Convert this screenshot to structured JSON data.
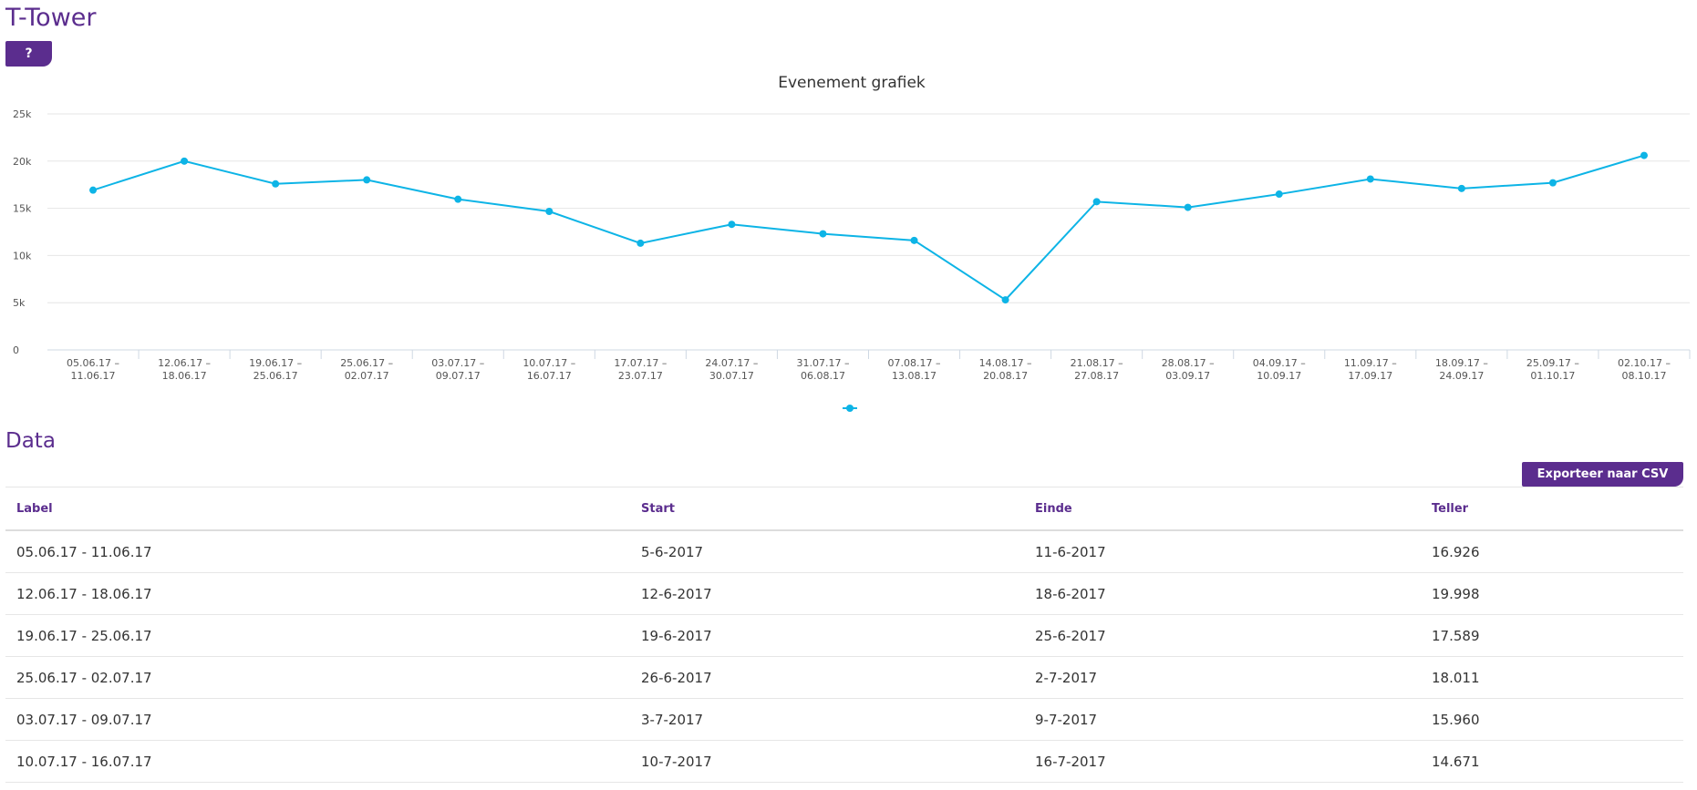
{
  "app": {
    "title": "T-Tower",
    "help_label": "?"
  },
  "data_section": {
    "title": "Data",
    "export_label": "Exporteer naar CSV"
  },
  "table": {
    "headers": {
      "label": "Label",
      "start": "Start",
      "end": "Einde",
      "count": "Teller"
    },
    "rows": [
      {
        "label": "05.06.17 - 11.06.17",
        "start": "5-6-2017",
        "end": "11-6-2017",
        "count": "16.926"
      },
      {
        "label": "12.06.17 - 18.06.17",
        "start": "12-6-2017",
        "end": "18-6-2017",
        "count": "19.998"
      },
      {
        "label": "19.06.17 - 25.06.17",
        "start": "19-6-2017",
        "end": "25-6-2017",
        "count": "17.589"
      },
      {
        "label": "25.06.17 - 02.07.17",
        "start": "26-6-2017",
        "end": "2-7-2017",
        "count": "18.011"
      },
      {
        "label": "03.07.17 - 09.07.17",
        "start": "3-7-2017",
        "end": "9-7-2017",
        "count": "15.960"
      },
      {
        "label": "10.07.17 - 16.07.17",
        "start": "10-7-2017",
        "end": "16-7-2017",
        "count": "14.671"
      }
    ]
  },
  "chart_data": {
    "type": "line",
    "title": "Evenement grafiek",
    "xlabel": "",
    "ylabel": "",
    "ylim": [
      0,
      25000
    ],
    "y_ticks": [
      {
        "value": 0,
        "label": "0"
      },
      {
        "value": 5000,
        "label": "5k"
      },
      {
        "value": 10000,
        "label": "10k"
      },
      {
        "value": 15000,
        "label": "15k"
      },
      {
        "value": 20000,
        "label": "20k"
      },
      {
        "value": 25000,
        "label": "25k"
      }
    ],
    "grid": true,
    "legend_position": "bottom",
    "categories": [
      [
        "05.06.17 –",
        "11.06.17"
      ],
      [
        "12.06.17 –",
        "18.06.17"
      ],
      [
        "19.06.17 –",
        "25.06.17"
      ],
      [
        "25.06.17 –",
        "02.07.17"
      ],
      [
        "03.07.17 –",
        "09.07.17"
      ],
      [
        "10.07.17 –",
        "16.07.17"
      ],
      [
        "17.07.17 –",
        "23.07.17"
      ],
      [
        "24.07.17 –",
        "30.07.17"
      ],
      [
        "31.07.17 –",
        "06.08.17"
      ],
      [
        "07.08.17 –",
        "13.08.17"
      ],
      [
        "14.08.17 –",
        "20.08.17"
      ],
      [
        "21.08.17 –",
        "27.08.17"
      ],
      [
        "28.08.17 –",
        "03.09.17"
      ],
      [
        "04.09.17 –",
        "10.09.17"
      ],
      [
        "11.09.17 –",
        "17.09.17"
      ],
      [
        "18.09.17 –",
        "24.09.17"
      ],
      [
        "25.09.17 –",
        "01.10.17"
      ],
      [
        "02.10.17 –",
        "08.10.17"
      ]
    ],
    "series": [
      {
        "color": "#0db4e6",
        "values": [
          16926,
          19998,
          17589,
          18011,
          15960,
          14671,
          11300,
          13300,
          12300,
          11600,
          5300,
          15700,
          15100,
          16500,
          18100,
          17100,
          17700,
          20600
        ]
      }
    ]
  }
}
